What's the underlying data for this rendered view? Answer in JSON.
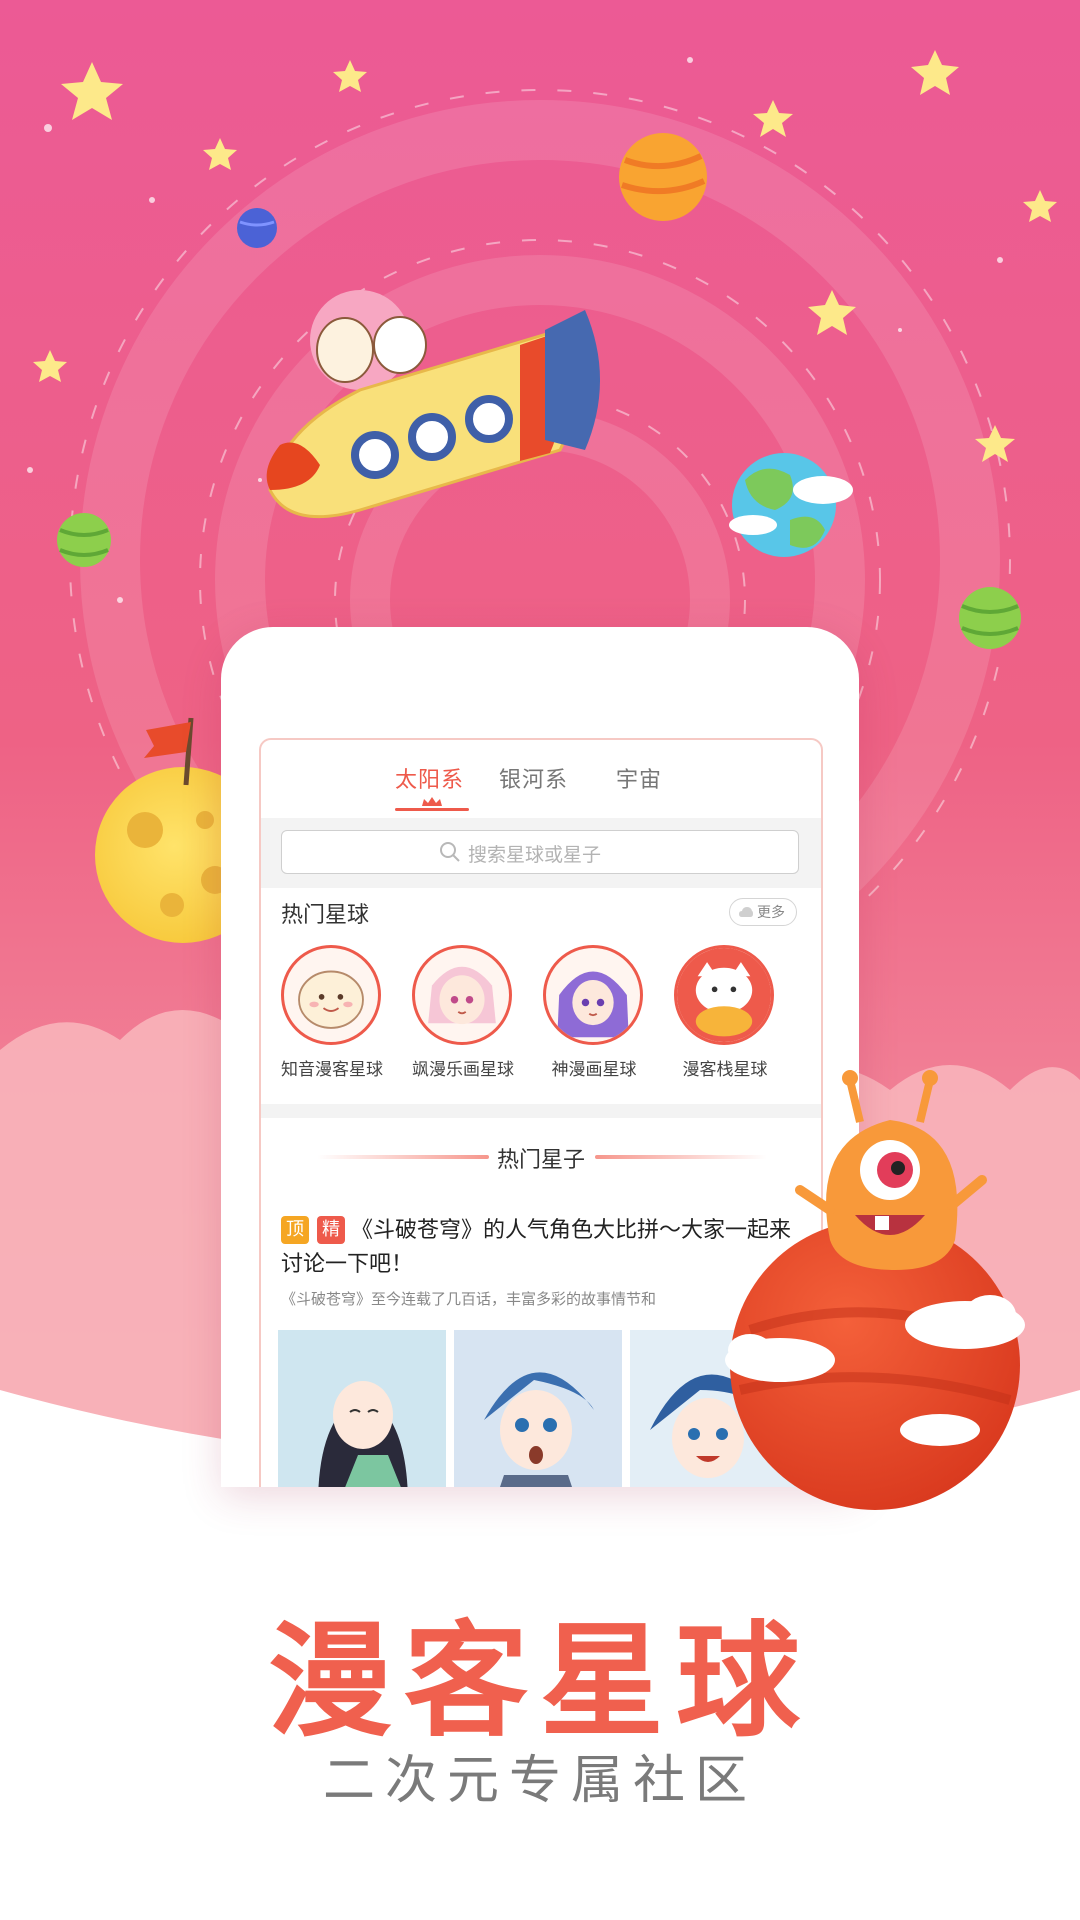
{
  "tabs": [
    {
      "label": "太阳系",
      "active": true
    },
    {
      "label": "银河系",
      "active": false
    },
    {
      "label": "宇宙",
      "active": false
    }
  ],
  "search": {
    "placeholder": "搜索星球或星子"
  },
  "hot_planets": {
    "title": "热门星球",
    "more_label": "更多",
    "items": [
      {
        "name": "知音漫客星球",
        "icon": "bun-character-avatar"
      },
      {
        "name": "飒漫乐画星球",
        "icon": "pink-hair-girl-avatar"
      },
      {
        "name": "神漫画星球",
        "icon": "purple-hair-girl-avatar"
      },
      {
        "name": "漫客栈星球",
        "icon": "white-cat-avatar"
      }
    ]
  },
  "hot_posts": {
    "title": "热门星子",
    "post": {
      "badge_top": "顶",
      "badge_essence": "精",
      "title": "《斗破苍穹》的人气角色大比拼～大家一起来讨论一下吧！",
      "summary": "《斗破苍穹》至今连载了几百话，丰富多彩的故事情节和"
    }
  },
  "promo": {
    "title": "漫客星球",
    "subtitle": "二次元专属社区"
  },
  "colors": {
    "accent": "#ee5a4b",
    "background_pink": "#ec5a8e",
    "title_red": "#f0604e",
    "badge_orange": "#f5a623"
  }
}
